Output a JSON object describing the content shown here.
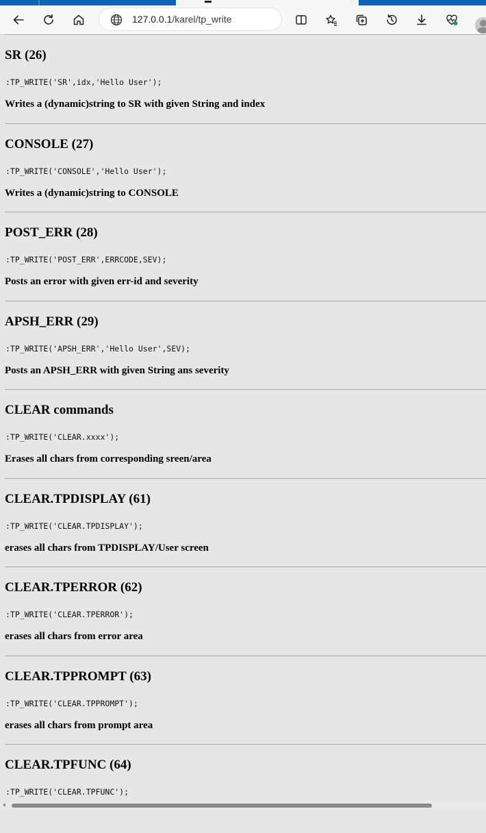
{
  "browser": {
    "url_host": "127.0.0.1",
    "url_path": "/karel/tp_write"
  },
  "icons": {
    "back": "back-arrow-icon",
    "refresh": "refresh-icon",
    "home": "home-icon",
    "site_info": "globe-icon",
    "split_screen": "split-screen-icon",
    "favorites": "favorites-star-icon",
    "collections": "collections-icon",
    "history": "history-icon",
    "downloads": "download-icon",
    "browser_essentials": "heartbeat-icon",
    "profile": "profile-avatar-icon"
  },
  "colors": {
    "page_background": "#e6e6e6",
    "tab_accent": "#0e63b7",
    "divider": "#a9a9a9"
  },
  "entries": [
    {
      "title": "SR (26)",
      "code": ":TP_WRITE('SR',idx,'Hello User');",
      "desc": "Writes a (dynamic)string to SR with given String and index"
    },
    {
      "title": "CONSOLE (27)",
      "code": ":TP_WRITE('CONSOLE','Hello User');",
      "desc": "Writes a (dynamic)string to CONSOLE"
    },
    {
      "title": "POST_ERR (28)",
      "code": ":TP_WRITE('POST_ERR',ERRCODE,SEV);",
      "desc": "Posts an error with given err-id and severity"
    },
    {
      "title": "APSH_ERR (29)",
      "code": ":TP_WRITE('APSH_ERR','Hello User',SEV);",
      "desc": "Posts an APSH_ERR with given String ans severity"
    },
    {
      "title": "CLEAR commands",
      "code": ":TP_WRITE('CLEAR.xxxx');",
      "desc": "Erases all chars from corresponding sreen/area"
    },
    {
      "title": "CLEAR.TPDISPLAY (61)",
      "code": ":TP_WRITE('CLEAR.TPDISPLAY');",
      "desc": "erases all chars from TPDISPLAY/User screen"
    },
    {
      "title": "CLEAR.TPERROR (62)",
      "code": ":TP_WRITE('CLEAR.TPERROR');",
      "desc": "erases all chars from error area"
    },
    {
      "title": "CLEAR.TPPROMPT (63)",
      "code": ":TP_WRITE('CLEAR.TPPROMPT');",
      "desc": "erases all chars from prompt area"
    },
    {
      "title": "CLEAR.TPFUNC (64)",
      "code": ":TP_WRITE('CLEAR.TPFUNC');",
      "desc": ""
    }
  ]
}
